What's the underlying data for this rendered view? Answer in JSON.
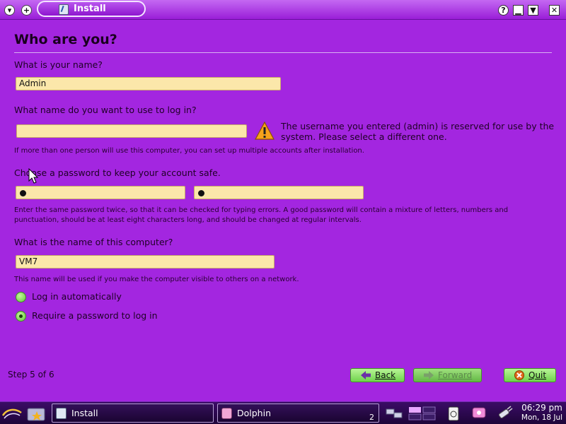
{
  "window": {
    "title": "Install",
    "controls": [
      "help-icon",
      "minimize-icon",
      "maximize-icon",
      "close-icon"
    ],
    "left_controls": [
      "chevron-down-icon",
      "plus-icon"
    ]
  },
  "page": {
    "heading": "Who are you?"
  },
  "name_section": {
    "label": "What is your name?",
    "value": "Admin"
  },
  "login_section": {
    "label": "What name do you want to use to log in?",
    "value": "",
    "warning": "The username you entered (admin) is reserved for use by the system. Please select a different one.",
    "hint": "If more than one person will use this computer, you can set up multiple accounts after installation."
  },
  "password_section": {
    "label": "Choose a password to keep your account safe.",
    "hint": "Enter the same password twice, so that it can be checked for typing errors. A good password will contain a mixture of letters, numbers and punctuation, should be at least eight characters long, and should be changed at regular intervals."
  },
  "computer_section": {
    "label": "What is the name of this computer?",
    "value": "VM7",
    "hint": "This name will be used if you make the computer visible to others on a network."
  },
  "login_options": [
    {
      "label": "Log in automatically",
      "checked": false
    },
    {
      "label": "Require a password to log in",
      "checked": true
    }
  ],
  "footer": {
    "step": "Step 5 of 6",
    "back": "Back",
    "forward": "Forward",
    "quit": "Quit"
  },
  "taskbar": {
    "tasks": [
      {
        "label": "Install",
        "icon": "installer-icon"
      },
      {
        "label": "Dolphin",
        "icon": "dolphin-icon",
        "badge": "2"
      }
    ],
    "clock": {
      "time": "06:29 pm",
      "date": "Mon, 18 Jul"
    }
  },
  "colors": {
    "background": "#a326e0",
    "field": "#fbe7aa",
    "button": "#7ad656",
    "taskbar": "#2a0850"
  }
}
